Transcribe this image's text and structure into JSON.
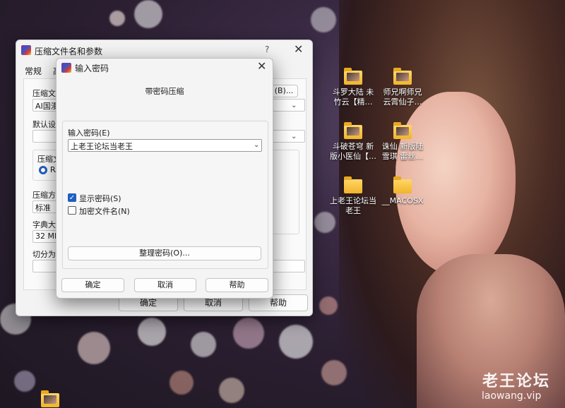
{
  "desktop": {
    "icons": [
      {
        "label": "斗罗大陆 未\n竹云【精…"
      },
      {
        "label": "师兄啊师兄\n云霄仙子…"
      },
      {
        "label": "斗破苍穹 新\n版小医仙【…"
      },
      {
        "label": "诛仙 新版陆\n雪琪 雷丝…"
      },
      {
        "label": "上老王论坛当\n老王"
      },
      {
        "label": "__MACOSX"
      }
    ],
    "watermark": {
      "logo": "老王论坛",
      "url": "laowang.vip"
    }
  },
  "back_dialog": {
    "title": "压缩文件名和参数",
    "help": "?",
    "close": "✕",
    "tabs": [
      "常规",
      "高"
    ],
    "labels": {
      "archive_name": "压缩文件",
      "default_settings": "默认设置",
      "archive_format": "压缩文",
      "compress_method": "压缩方式",
      "dict_size": "字典大小",
      "split": "切分为分"
    },
    "values": {
      "archive_name": "AI国漫",
      "radio": "RA",
      "method": "标准",
      "dict": "32 MB",
      "browse_button": "(B)..."
    },
    "buttons": {
      "ok": "确定",
      "cancel": "取消",
      "help": "帮助"
    }
  },
  "front_dialog": {
    "title": "输入密码",
    "close": "✕",
    "heading": "带密码压缩",
    "password_label": "输入密码(E)",
    "password_value": "上老王论坛当老王",
    "show_password": {
      "label": "显示密码(S)",
      "checked": true
    },
    "encrypt_names": {
      "label": "加密文件名(N)",
      "checked": false
    },
    "organize_button": "整理密码(O)...",
    "buttons": {
      "ok": "确定",
      "cancel": "取消",
      "help": "帮助"
    }
  }
}
